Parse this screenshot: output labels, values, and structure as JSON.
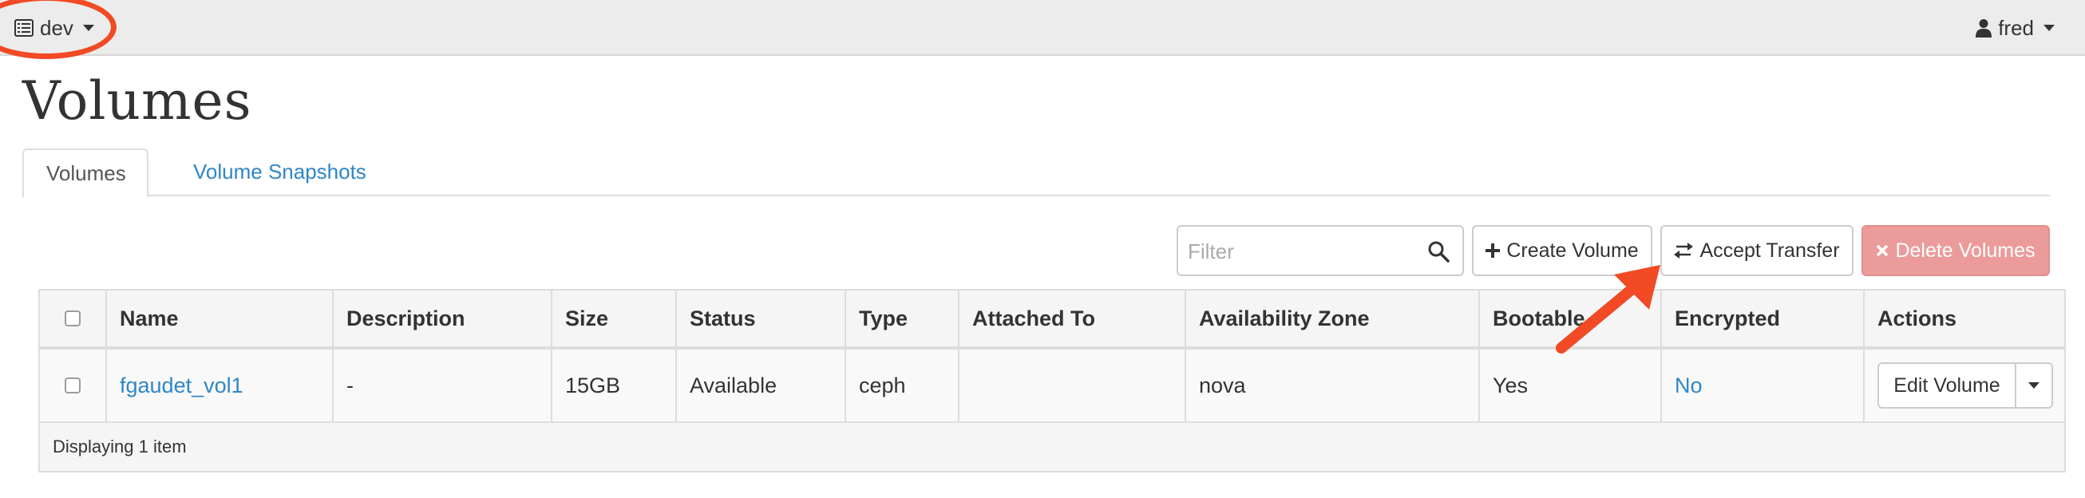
{
  "nav": {
    "project": "dev",
    "user": "fred"
  },
  "page": {
    "title": "Volumes"
  },
  "tabs": [
    {
      "label": "Volumes",
      "active": true
    },
    {
      "label": "Volume Snapshots",
      "active": false
    }
  ],
  "toolbar": {
    "filter_placeholder": "Filter",
    "create_label": "Create Volume",
    "accept_label": "Accept Transfer",
    "delete_label": "Delete Volumes"
  },
  "table": {
    "columns": [
      "Name",
      "Description",
      "Size",
      "Status",
      "Type",
      "Attached To",
      "Availability Zone",
      "Bootable",
      "Encrypted",
      "Actions"
    ],
    "rows": [
      {
        "name": "fgaudet_vol1",
        "description": "-",
        "size": "15GB",
        "status": "Available",
        "type": "ceph",
        "attached_to": "",
        "availability_zone": "nova",
        "bootable": "Yes",
        "encrypted": "No",
        "action_label": "Edit Volume"
      }
    ],
    "footer": "Displaying 1 item"
  },
  "icons": {
    "project": "list-icon",
    "user": "user-icon",
    "search": "search-icon",
    "create": "plus-icon",
    "accept": "exchange-icon",
    "delete": "times-icon"
  },
  "colors": {
    "accent": "#2f86c6",
    "danger": "#eb9b9a",
    "annotation": "#f14a24"
  }
}
